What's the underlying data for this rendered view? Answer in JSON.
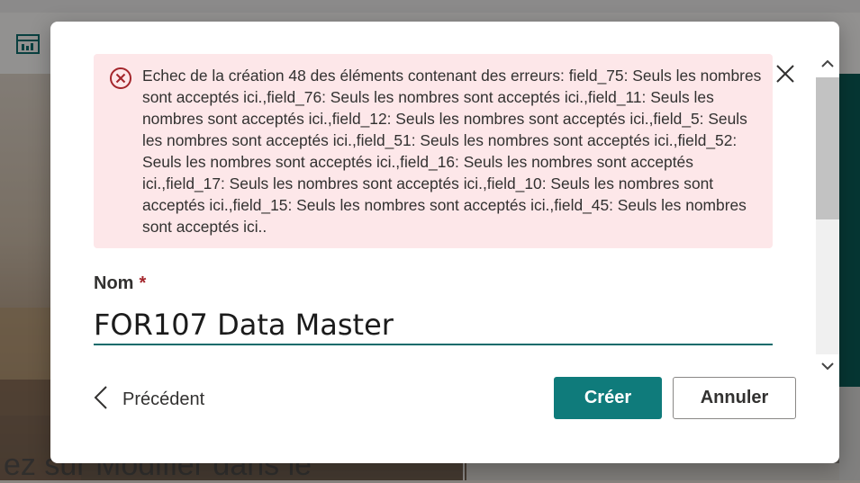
{
  "background": {
    "hero_text": "ez sur Modifier dans le"
  },
  "dialog": {
    "error_message": "Echec de la création 48 des éléments contenant des erreurs: field_75: Seuls les nombres sont acceptés ici.,field_76: Seuls les nombres sont acceptés ici.,field_11: Seuls les nombres sont acceptés ici.,field_12: Seuls les nombres sont acceptés ici.,field_5: Seuls les nombres sont acceptés ici.,field_51: Seuls les nombres sont acceptés ici.,field_52: Seuls les nombres sont acceptés ici.,field_16: Seuls les nombres sont acceptés ici.,field_17: Seuls les nombres sont acceptés ici.,field_10: Seuls les nombres sont acceptés ici.,field_15: Seuls les nombres sont acceptés ici.,field_45: Seuls les nombres sont acceptés ici..",
    "name_label": "Nom",
    "required_marker": "*",
    "name_value": "FOR107 Data Master",
    "back_label": "Précédent",
    "create_label": "Créer",
    "cancel_label": "Annuler"
  },
  "icons": {
    "error": "error-circle-icon",
    "close": "close-icon",
    "back": "chevron-left-icon",
    "scroll_up": "chevron-up-icon",
    "scroll_down": "chevron-down-icon",
    "app": "table-icon"
  },
  "colors": {
    "accent": "#0f7b7b",
    "error_bg": "#fde7e9",
    "error_icon": "#a4262c",
    "input_underline": "#0f6b6b"
  }
}
